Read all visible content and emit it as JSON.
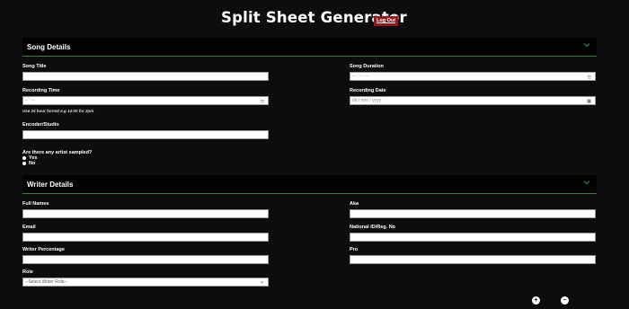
{
  "header": {
    "title": "Split Sheet Generator",
    "logout_label": "Log Out"
  },
  "song_details": {
    "section_title": "Song Details",
    "song_title_label": "Song Title",
    "song_duration_label": "Song Duration",
    "song_duration_value": "-- : -- : --",
    "recording_time_label": "Recording Time",
    "recording_time_value": "-- : --",
    "recording_time_hint": "Use 24 hour format e.g 14:00 for 2pm",
    "recording_date_label": "Recording Date",
    "recording_date_value": "dd / mm / yyyy",
    "encoder_label": "Encoder/Studio",
    "sampled_question": "Are there any artist sampled?",
    "sampled_options": [
      "Yes",
      "No"
    ]
  },
  "writer_details": {
    "section_title": "Writer Details",
    "full_names_label": "Full Names",
    "aka_label": "Aka",
    "email_label": "Email",
    "national_id_label": "National ID/Reg. No",
    "writer_percentage_label": "Writer Percentage",
    "pro_label": "Pro",
    "role_label": "Role",
    "role_select_value": "--Select Writer Role--",
    "add_button": "+",
    "remove_button": "−"
  },
  "colors": {
    "background": "#0d0d0f",
    "section_bar": "#020203",
    "accent_line": "#3a7d3a",
    "logout_bg": "#8b1a22"
  }
}
